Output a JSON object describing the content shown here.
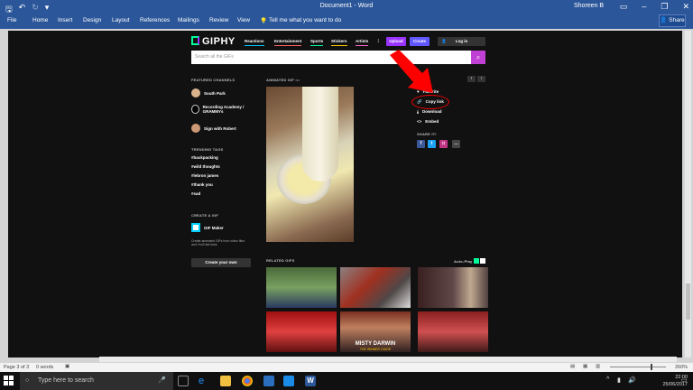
{
  "window": {
    "title": "Document1 - Word",
    "user": "Shoreen B",
    "share": "Share"
  },
  "ribbon": {
    "tabs": [
      "File",
      "Home",
      "Insert",
      "Design",
      "Layout",
      "References",
      "Mailings",
      "Review",
      "View"
    ],
    "tell_me": "Tell me what you want to do"
  },
  "giphy": {
    "logo": "GIPHY",
    "nav": [
      "Reactions",
      "Entertainment",
      "Sports",
      "Stickers",
      "Artists"
    ],
    "more": "⋮",
    "upload": "Upload",
    "create": "Create",
    "login": "Log in",
    "search_placeholder": "Search all the GIFs",
    "featured_heading": "FEATURED CHANNELS",
    "channels": [
      "South Park",
      "Recording Academy / GRAMMYs",
      "Sign with Robert"
    ],
    "trending_heading": "TRENDING TAGS",
    "tags": [
      "#backpacking",
      "#wild thoughts",
      "#lebron james",
      "#thank you",
      "#sad"
    ],
    "create_heading": "CREATE A GIF",
    "gif_maker": "GIF Maker",
    "gif_maker_desc": "Create animated GIFs from video files and YouTube links",
    "create_own": "Create your own",
    "animated_label": "ANIMATED GIF",
    "actions": {
      "favorite": "Favorite",
      "copy_link": "Copy link",
      "download": "Download",
      "embed": "Embed"
    },
    "share_heading": "SHARE IT!",
    "related_heading": "RELATED GIFS",
    "autoplay": "Auto-Play",
    "thumb_caption_1": "MISTY DARWIN",
    "thumb_caption_2": "THE WINNER GUIDE"
  },
  "status": {
    "page": "Page 3 of 3",
    "words": "0 words",
    "zoom": "260%"
  },
  "taskbar": {
    "search": "Type here to search",
    "time": "22:00",
    "date": "25/06/2017"
  },
  "colors": {
    "word_blue": "#2b579a",
    "giphy_purple": "#9933ff",
    "giphy_search": "#c03fd4",
    "annotation_red": "#ff0000"
  }
}
